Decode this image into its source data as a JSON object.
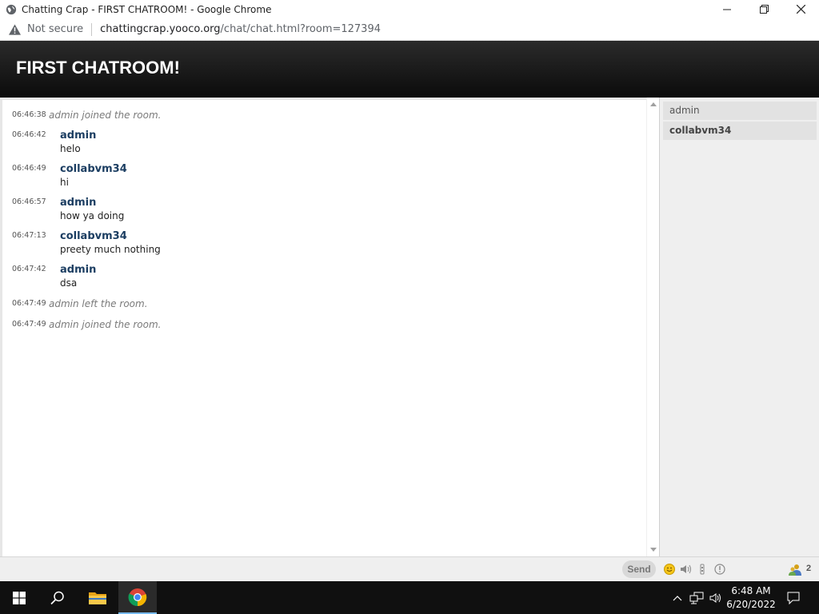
{
  "window": {
    "title": "Chatting Crap - FIRST CHATROOM! - Google Chrome"
  },
  "addressbar": {
    "security_label": "Not secure",
    "url_host": "chattingcrap.yooco.org",
    "url_path": "/chat/chat.html?room=127394"
  },
  "page": {
    "room_title": "FIRST CHATROOM!"
  },
  "messages": [
    {
      "time": "06:46:38",
      "type": "system",
      "text": "admin joined the room."
    },
    {
      "time": "06:46:42",
      "type": "chat",
      "user": "admin",
      "text": "helo"
    },
    {
      "time": "06:46:49",
      "type": "chat",
      "user": "collabvm34",
      "text": "hi"
    },
    {
      "time": "06:46:57",
      "type": "chat",
      "user": "admin",
      "text": "how ya doing"
    },
    {
      "time": "06:47:13",
      "type": "chat",
      "user": "collabvm34",
      "text": "preety much nothing"
    },
    {
      "time": "06:47:42",
      "type": "chat",
      "user": "admin",
      "text": "dsa"
    },
    {
      "time": "06:47:49",
      "type": "system",
      "text": "admin left the room."
    },
    {
      "time": "06:47:49",
      "type": "system",
      "text": "admin joined the room."
    }
  ],
  "users": [
    {
      "name": "admin",
      "is_self": false
    },
    {
      "name": "collabvm34",
      "is_self": true
    }
  ],
  "input": {
    "message_value": "",
    "send_label": "Send",
    "user_count": "2",
    "icons": [
      "smiley-icon",
      "sound-icon",
      "notification-icon",
      "info-icon",
      "users-icon"
    ]
  },
  "taskbar": {
    "time": "6:48 AM",
    "date": "6/20/2022",
    "pinned": [
      "start-button",
      "search-icon",
      "file-explorer-icon",
      "chrome-icon"
    ]
  },
  "colors": {
    "username": "#1c3e62",
    "header_bg": "#1a1a1a",
    "taskbar_bg": "#101010"
  }
}
